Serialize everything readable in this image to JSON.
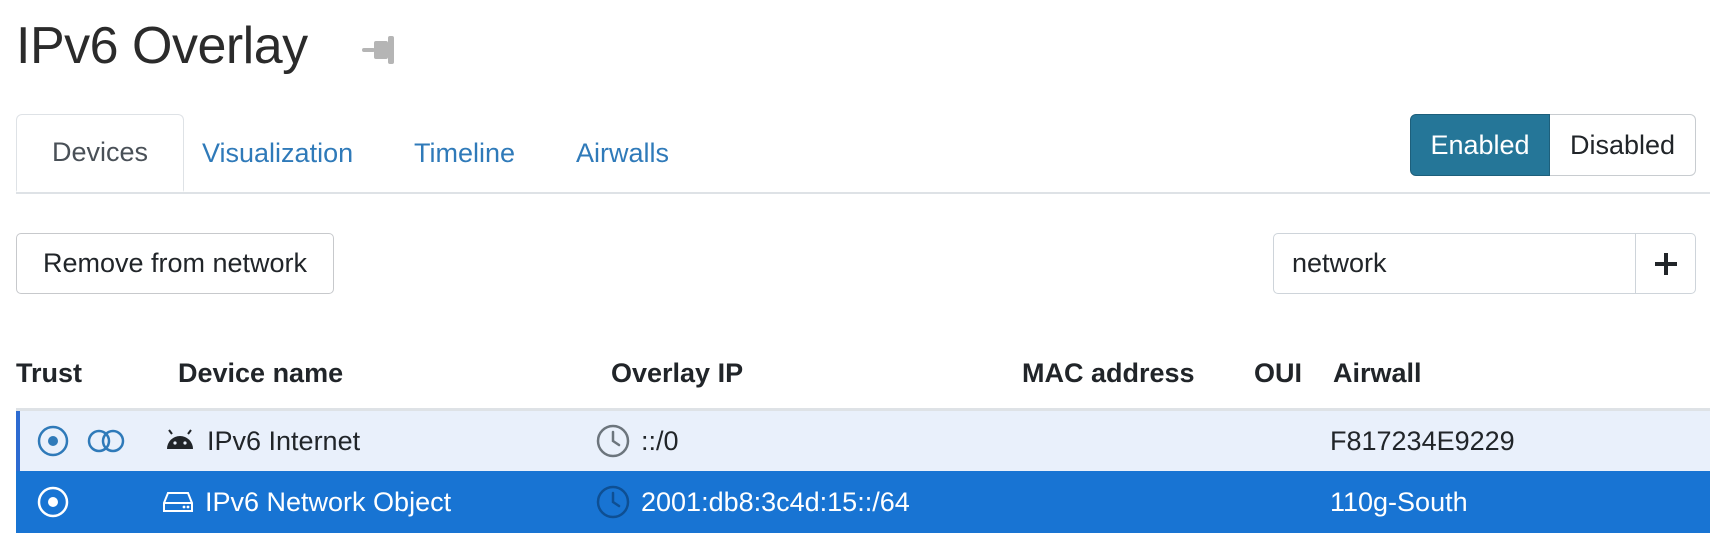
{
  "header": {
    "title": "IPv6 Overlay",
    "pin_icon": "pin-icon"
  },
  "tabs": [
    {
      "label": "Devices",
      "active": true
    },
    {
      "label": "Visualization",
      "active": false
    },
    {
      "label": "Timeline",
      "active": false
    },
    {
      "label": "Airwalls",
      "active": false
    }
  ],
  "status_toggle": {
    "enabled_label": "Enabled",
    "disabled_label": "Disabled",
    "selected": "Enabled"
  },
  "toolbar": {
    "remove_label": "Remove from network",
    "add_icon": "plus-icon"
  },
  "search": {
    "value": "network"
  },
  "table": {
    "columns": [
      "Trust",
      "Device name",
      "Overlay IP",
      "MAC address",
      "OUI",
      "Airwall"
    ],
    "rows": [
      {
        "trust_icons": [
          "radio-target-icon",
          "toggle-links-icon"
        ],
        "device_icon": "android-icon",
        "device_name": "IPv6 Internet",
        "ip_icon": "clock-icon",
        "overlay_ip": "::/0",
        "mac": "",
        "oui": "",
        "airwall": "F817234E9229",
        "selected": false
      },
      {
        "trust_icons": [
          "radio-target-icon"
        ],
        "device_icon": "hard-drive-icon",
        "device_name": "IPv6 Network Object",
        "ip_icon": "clock-icon",
        "overlay_ip": "2001:db8:3c4d:15::/64",
        "mac": "",
        "oui": "",
        "airwall": "110g-South",
        "selected": true
      }
    ]
  },
  "colors": {
    "accent": "#2f7ab9",
    "enabled_bg": "#257698",
    "row_highlight": "#e9f0fb",
    "row_selected": "#1874d3"
  }
}
